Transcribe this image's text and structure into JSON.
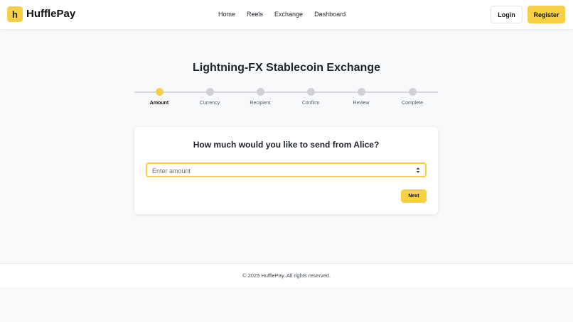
{
  "brand": {
    "logo_letter": "h",
    "name": "HufflePay"
  },
  "nav": {
    "items": [
      "Home",
      "Reels",
      "Exchange",
      "Dashboard"
    ]
  },
  "auth": {
    "login_label": "Login",
    "register_label": "Register"
  },
  "page": {
    "title": "Lightning-FX Stablecoin Exchange"
  },
  "stepper": {
    "active_index": 0,
    "steps": [
      "Amount",
      "Currency",
      "Recipient",
      "Confirm",
      "Review",
      "Complete"
    ]
  },
  "form": {
    "question": "How much would you like to send from Alice?",
    "amount_placeholder": "Enter amount",
    "amount_value": "",
    "next_label": "Next"
  },
  "footer": {
    "text": "© 2025 HufflePay. All rights reserved."
  },
  "colors": {
    "accent": "#f7d046",
    "background": "#f8f9fb",
    "inactive_step": "#cfd1d5"
  },
  "icons": {
    "input_spinner": "number-spinner-icon"
  }
}
